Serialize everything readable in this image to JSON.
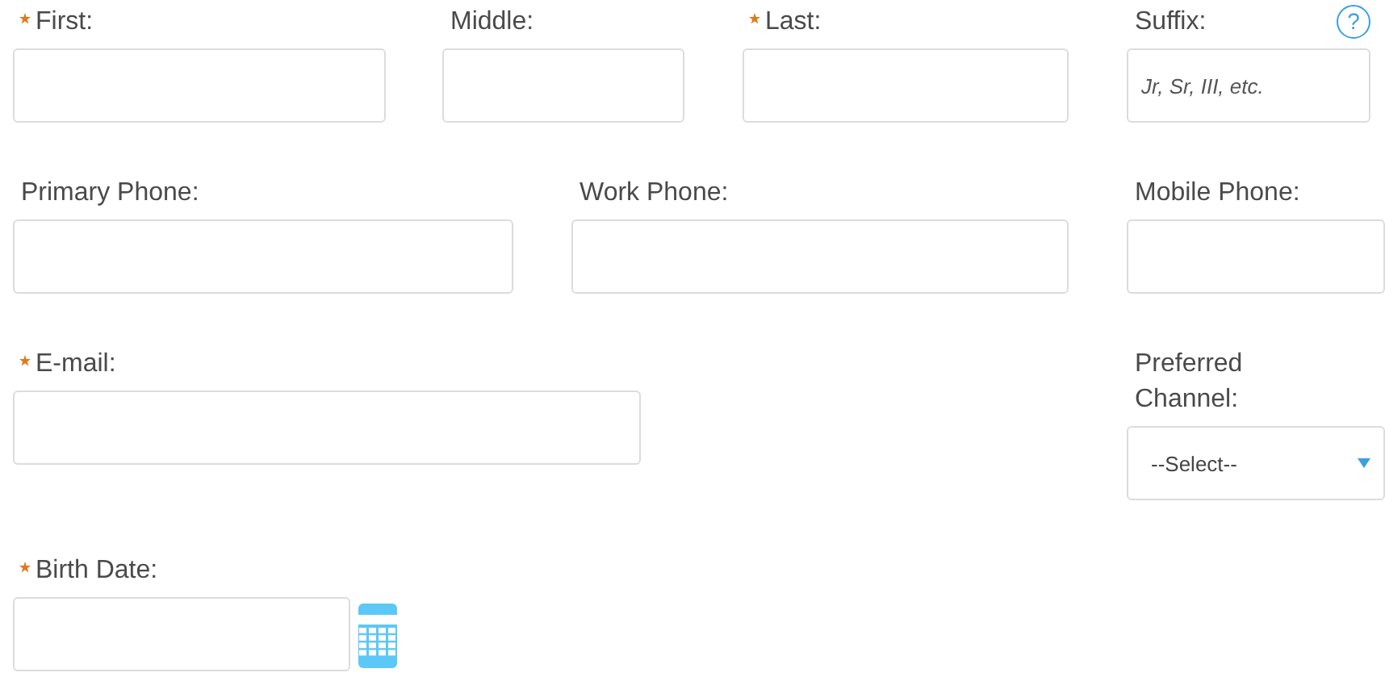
{
  "rows": [
    {
      "fields": [
        {
          "kind": "text",
          "label": "First:",
          "required": true
        },
        {
          "kind": "text",
          "label": "Middle:",
          "required": false
        },
        {
          "kind": "text",
          "label": "Last:",
          "required": true
        },
        {
          "kind": "text",
          "label": "Suffix:",
          "required": false,
          "placeholder": "Jr, Sr, III, etc.",
          "help": "?"
        }
      ]
    },
    {
      "fields": [
        {
          "kind": "text",
          "label": "Primary Phone:",
          "required": false
        },
        {
          "kind": "text",
          "label": "Work Phone:",
          "required": false
        },
        {
          "kind": "text",
          "label": "Mobile Phone:",
          "required": false
        }
      ]
    },
    {
      "fields": [
        {
          "kind": "text",
          "label": "E-mail:",
          "required": true
        },
        {
          "kind": "select",
          "label": "Preferred Channel:",
          "required": false,
          "value": "--Select--"
        }
      ]
    },
    {
      "fields": [
        {
          "kind": "date",
          "label": "Birth Date:",
          "required": true
        }
      ]
    }
  ]
}
